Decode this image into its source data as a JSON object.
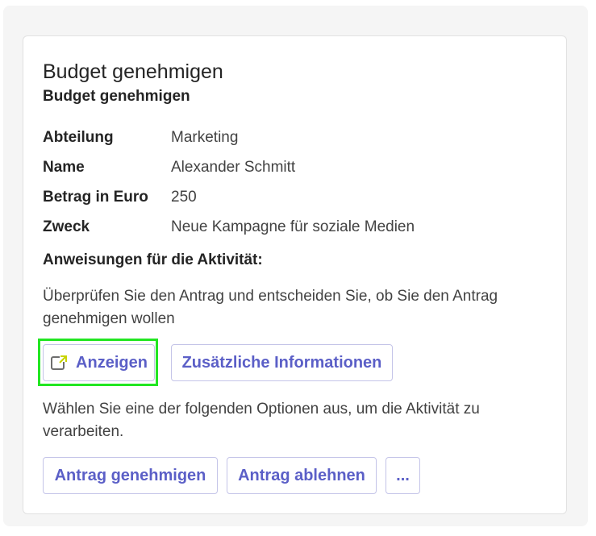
{
  "card": {
    "title": "Budget genehmigen",
    "subtitle": "Budget genehmigen",
    "facts": [
      {
        "key": "Abteilung",
        "value": "Marketing"
      },
      {
        "key": "Name",
        "value": "Alexander Schmitt"
      },
      {
        "key": "Betrag in Euro",
        "value": "250"
      },
      {
        "key": "Zweck",
        "value": "Neue Kampagne für soziale Medien"
      }
    ],
    "instructions_heading": "Anweisungen für die Aktivität:",
    "instructions_text": "Überprüfen Sie den Antrag und entscheiden Sie, ob Sie den Antrag genehmigen wollen",
    "choose_text": "Wählen Sie eine der folgenden Optionen aus, um die Aktivität zu verarbeiten."
  },
  "buttons": {
    "view": {
      "label": "Anzeigen",
      "icon": "open-external-icon"
    },
    "more_info": {
      "label": "Zusätzliche Informationen"
    },
    "approve": {
      "label": "Antrag genehmigen"
    },
    "reject": {
      "label": "Antrag ablehnen"
    },
    "overflow": {
      "label": "..."
    }
  },
  "colors": {
    "accent": "#5b5fc7",
    "highlight": "#22e622",
    "icon_accent": "#c8d400"
  }
}
